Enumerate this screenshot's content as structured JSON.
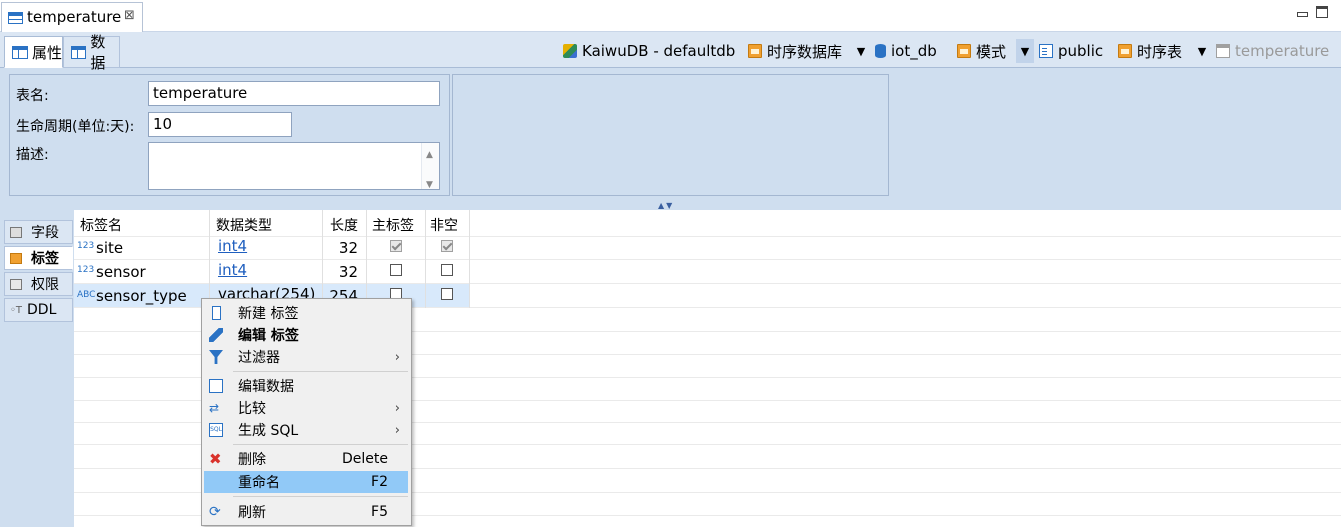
{
  "editor_tab": {
    "title": "temperature",
    "close": "⊠"
  },
  "subtabs": {
    "properties": "属性",
    "data": "数据"
  },
  "breadcrumb": {
    "connection": "KaiwuDB - defaultdb",
    "database_type": "时序数据库",
    "database": "iot_db",
    "schema_label": "模式",
    "schema": "public",
    "table_type": "时序表",
    "table": "temperature"
  },
  "form": {
    "table_name_label": "表名:",
    "table_name_value": "temperature",
    "lifetime_label": "生命周期(单位:天):",
    "lifetime_value": "10",
    "description_label": "描述:",
    "description_value": ""
  },
  "sidetabs": {
    "fields": "字段",
    "tags": "标签",
    "permissions": "权限",
    "ddl": "DDL"
  },
  "grid": {
    "headers": {
      "tag_name": "标签名",
      "data_type": "数据类型",
      "length": "长度",
      "primary_tag": "主标签",
      "not_null": "非空"
    },
    "rows": [
      {
        "type_icon": "123",
        "name": "site",
        "data_type": "int4",
        "length": "32",
        "primary_tag": true,
        "not_null": true
      },
      {
        "type_icon": "123",
        "name": "sensor",
        "data_type": "int4",
        "length": "32",
        "primary_tag": false,
        "not_null": false
      },
      {
        "type_icon": "ABC",
        "name": "sensor_type",
        "data_type": "varchar(254)",
        "length": "254",
        "primary_tag": false,
        "not_null": false
      }
    ]
  },
  "context_menu": {
    "new_tag": "新建 标签",
    "edit_tag": "编辑 标签",
    "filters": "过滤器",
    "edit_data": "编辑数据",
    "compare": "比较",
    "generate_sql": "生成 SQL",
    "delete": "删除",
    "delete_shortcut": "Delete",
    "rename": "重命名",
    "rename_shortcut": "F2",
    "refresh": "刷新",
    "refresh_shortcut": "F5",
    "submenu_arrow": "›"
  },
  "colors": {
    "panel_bg": "#cfdeef",
    "selection": "#91c9f7",
    "row_selected": "#d8e9fb",
    "link": "#1f5fbf",
    "delete_icon": "#d9322b"
  }
}
